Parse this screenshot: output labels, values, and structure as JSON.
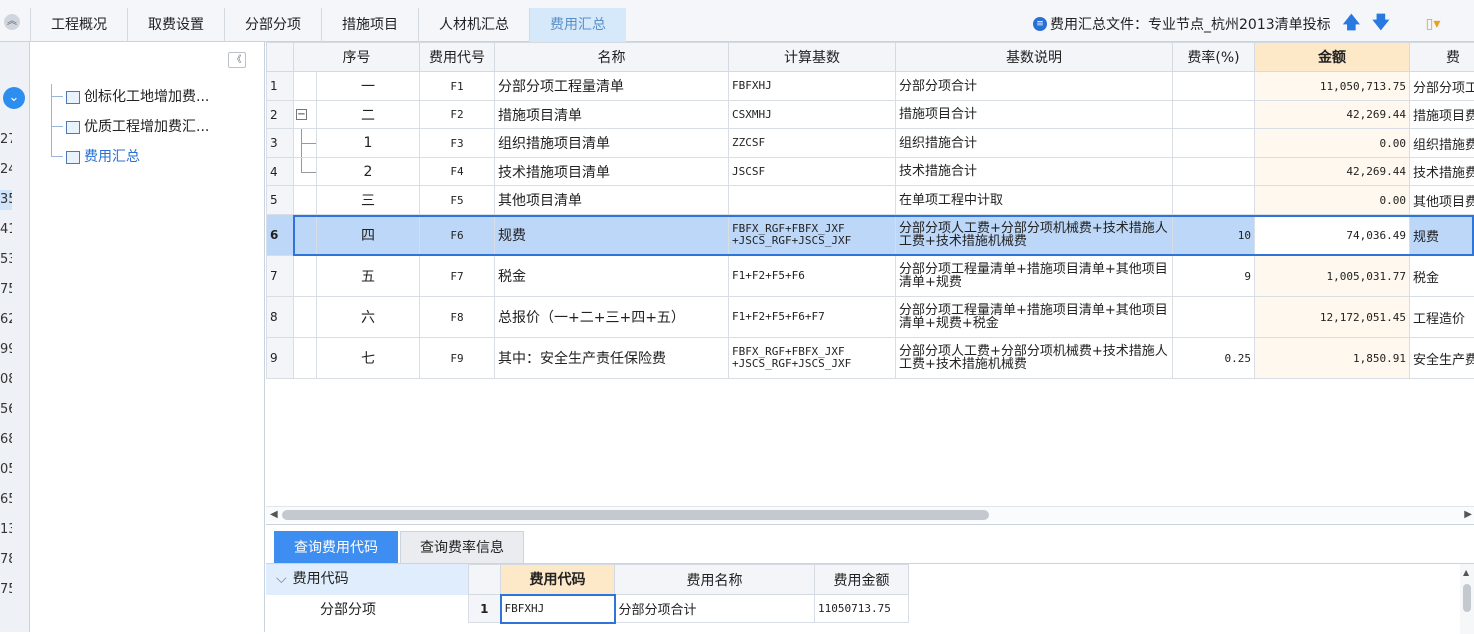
{
  "top_tabs": [
    {
      "label": "工程概况"
    },
    {
      "label": "取费设置"
    },
    {
      "label": "分部分项"
    },
    {
      "label": "措施项目"
    },
    {
      "label": "人材机汇总"
    },
    {
      "label": "费用汇总"
    }
  ],
  "active_tab": "费用汇总",
  "file_label": "费用汇总文件：专业节点_杭州2013清单投标",
  "left_strip_numbers": [
    "27",
    "24",
    "35",
    "41",
    "53",
    "75",
    "62",
    "99",
    "08",
    "56",
    "68",
    "05",
    "65",
    "13",
    "78",
    "75"
  ],
  "tree": {
    "items": [
      {
        "label": "创标化工地增加费..."
      },
      {
        "label": "优质工程增加费汇..."
      },
      {
        "label": "费用汇总"
      }
    ]
  },
  "grid": {
    "headers": [
      "序号",
      "费用代号",
      "名称",
      "计算基数",
      "基数说明",
      "费率(%)",
      "金额",
      "费"
    ],
    "rows": [
      {
        "idx": "1",
        "seq": "一",
        "code": "F1",
        "name": "分部分项工程量清单",
        "basis": "FBFXHJ",
        "desc": "分部分项合计",
        "rate": "",
        "amount": "11,050,713.75",
        "remark": "分部分项工"
      },
      {
        "idx": "2",
        "seq": "二",
        "code": "F2",
        "name": "措施项目清单",
        "basis": "CSXMHJ",
        "desc": "措施项目合计",
        "rate": "",
        "amount": "42,269.44",
        "remark": "措施项目费"
      },
      {
        "idx": "3",
        "seq": "1",
        "code": "F3",
        "name": "组织措施项目清单",
        "basis": "ZZCSF",
        "desc": "组织措施合计",
        "rate": "",
        "amount": "0.00",
        "remark": "组织措施费"
      },
      {
        "idx": "4",
        "seq": "2",
        "code": "F4",
        "name": "技术措施项目清单",
        "basis": "JSCSF",
        "desc": "技术措施合计",
        "rate": "",
        "amount": "42,269.44",
        "remark": "技术措施费"
      },
      {
        "idx": "5",
        "seq": "三",
        "code": "F5",
        "name": "其他项目清单",
        "basis": "",
        "desc": "在单项工程中计取",
        "rate": "",
        "amount": "0.00",
        "remark": "其他项目费"
      },
      {
        "idx": "6",
        "seq": "四",
        "code": "F6",
        "name": "规费",
        "basis": "FBFX_RGF+FBFX_JXF +JSCS_RGF+JSCS_JXF",
        "desc": "分部分项人工费+分部分项机械费+技术措施人工费+技术措施机械费",
        "rate": "10",
        "amount": "74,036.49",
        "remark": "规费"
      },
      {
        "idx": "7",
        "seq": "五",
        "code": "F7",
        "name": "税金",
        "basis": "F1+F2+F5+F6",
        "desc": "分部分项工程量清单+措施项目清单+其他项目清单+规费",
        "rate": "9",
        "amount": "1,005,031.77",
        "remark": "税金"
      },
      {
        "idx": "8",
        "seq": "六",
        "code": "F8",
        "name": "总报价（一+二+三+四+五）",
        "basis": "F1+F2+F5+F6+F7",
        "desc": "分部分项工程量清单+措施项目清单+其他项目清单+规费+税金",
        "rate": "",
        "amount": "12,172,051.45",
        "remark": "工程造价"
      },
      {
        "idx": "9",
        "seq": "七",
        "code": "F9",
        "name": "其中：安全生产责任保险费",
        "basis": "FBFX_RGF+FBFX_JXF +JSCS_RGF+JSCS_JXF",
        "desc": "分部分项人工费+分部分项机械费+技术措施人工费+技术措施机械费",
        "rate": "0.25",
        "amount": "1,850.91",
        "remark": "安全生产费"
      }
    ]
  },
  "bottom": {
    "tabs": [
      {
        "label": "查询费用代码"
      },
      {
        "label": "查询费率信息"
      }
    ],
    "code_tree_head": "费用代码",
    "code_tree_sub": "分部分项",
    "code_grid_headers": [
      "费用代码",
      "费用名称",
      "费用金额"
    ],
    "code_rows": [
      {
        "idx": "1",
        "code": "FBFXHJ",
        "name": "分部分项合计",
        "amount": "11050713.75"
      }
    ]
  },
  "colors": {
    "accent": "#2d75d8",
    "active_tab_bg": "#d6e9fb",
    "amount_header": "#fde8c8",
    "selected_row": "#bcd7f8",
    "bottom_tab_active": "#3d8ef0"
  },
  "icons": [
    "circle-collapse-icon",
    "file-info-icon",
    "arrow-up-icon",
    "arrow-down-icon",
    "tools-icon",
    "collapse-left-icon",
    "doc-icon",
    "expand-minus-icon",
    "chevron-down-icon"
  ]
}
